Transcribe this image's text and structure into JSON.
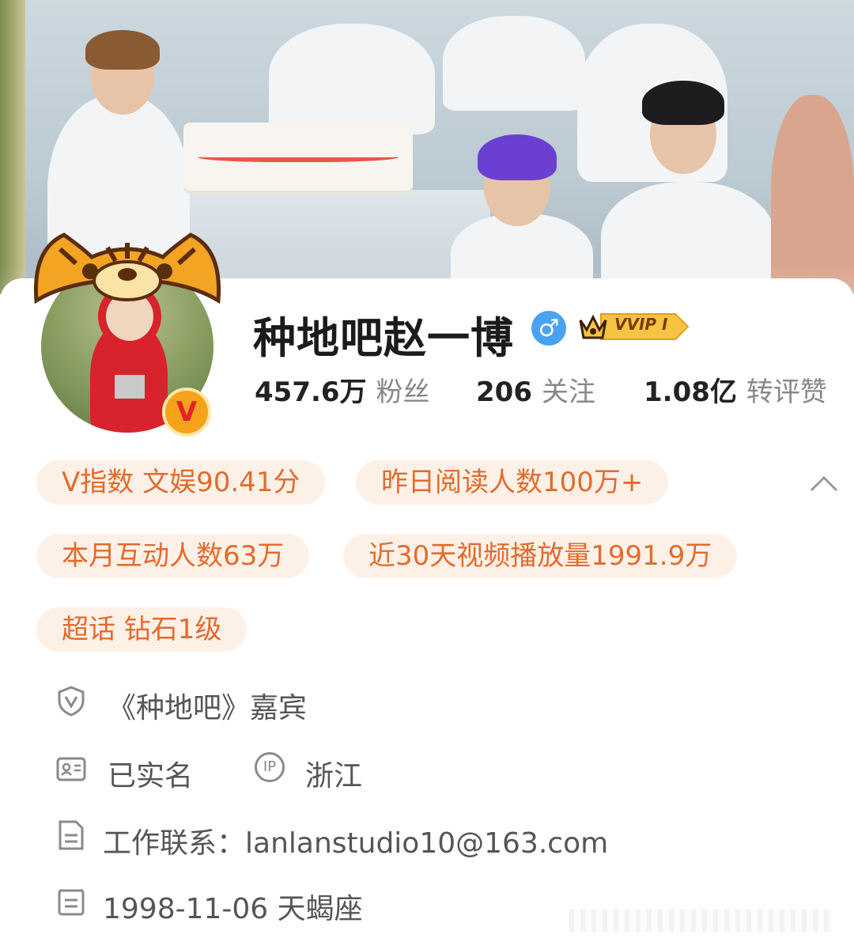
{
  "profile": {
    "name": "种地吧赵一博",
    "gender_symbol": "♂",
    "vip_label": "VVIP I",
    "verified_badge": "V"
  },
  "stats": [
    {
      "value": "457.6万",
      "label": "粉丝"
    },
    {
      "value": "206",
      "label": "关注"
    },
    {
      "value": "1.08亿",
      "label": "转评赞"
    }
  ],
  "tags": [
    "V指数 文娱90.41分",
    "昨日阅读人数100万+",
    "本月互动人数63万",
    "近30天视频播放量1991.9万",
    "超话 钻石1级"
  ],
  "info": {
    "title": "《种地吧》嘉宾",
    "real_name": "已实名",
    "ip_label": "IP",
    "ip_location": "浙江",
    "contact": "工作联系：lanlanstudio10@163.com",
    "birthday": "1998-11-06 天蝎座"
  },
  "icons": {
    "shield": "shield-v-icon",
    "id_card": "id-card-icon",
    "ip": "ip-icon",
    "document": "document-icon",
    "calendar": "calendar-icon",
    "collapse": "chevron-up-icon"
  },
  "colors": {
    "tag_bg": "#fdf1e7",
    "tag_text": "#e46a2c",
    "gender": "#4aa3f0",
    "vip_gold": "#f6c343"
  }
}
